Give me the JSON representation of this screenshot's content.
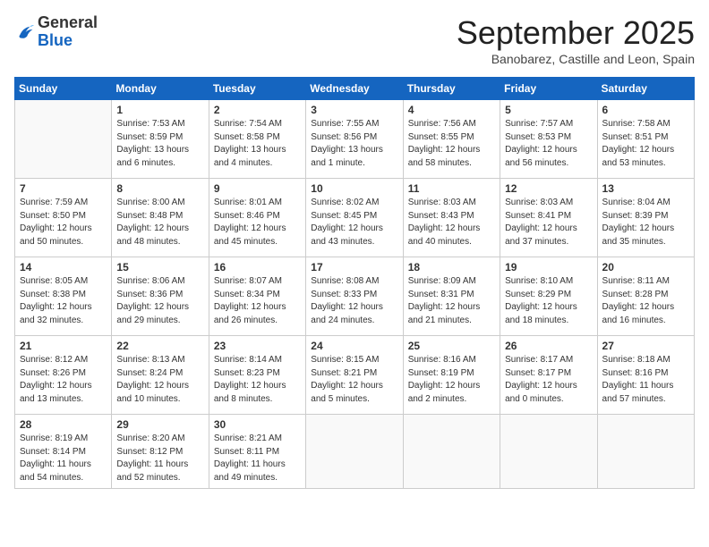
{
  "header": {
    "logo_general": "General",
    "logo_blue": "Blue",
    "month_title": "September 2025",
    "subtitle": "Banobarez, Castille and Leon, Spain"
  },
  "weekdays": [
    "Sunday",
    "Monday",
    "Tuesday",
    "Wednesday",
    "Thursday",
    "Friday",
    "Saturday"
  ],
  "weeks": [
    [
      {
        "day": "",
        "sunrise": "",
        "sunset": "",
        "daylight": ""
      },
      {
        "day": "1",
        "sunrise": "Sunrise: 7:53 AM",
        "sunset": "Sunset: 8:59 PM",
        "daylight": "Daylight: 13 hours and 6 minutes."
      },
      {
        "day": "2",
        "sunrise": "Sunrise: 7:54 AM",
        "sunset": "Sunset: 8:58 PM",
        "daylight": "Daylight: 13 hours and 4 minutes."
      },
      {
        "day": "3",
        "sunrise": "Sunrise: 7:55 AM",
        "sunset": "Sunset: 8:56 PM",
        "daylight": "Daylight: 13 hours and 1 minute."
      },
      {
        "day": "4",
        "sunrise": "Sunrise: 7:56 AM",
        "sunset": "Sunset: 8:55 PM",
        "daylight": "Daylight: 12 hours and 58 minutes."
      },
      {
        "day": "5",
        "sunrise": "Sunrise: 7:57 AM",
        "sunset": "Sunset: 8:53 PM",
        "daylight": "Daylight: 12 hours and 56 minutes."
      },
      {
        "day": "6",
        "sunrise": "Sunrise: 7:58 AM",
        "sunset": "Sunset: 8:51 PM",
        "daylight": "Daylight: 12 hours and 53 minutes."
      }
    ],
    [
      {
        "day": "7",
        "sunrise": "Sunrise: 7:59 AM",
        "sunset": "Sunset: 8:50 PM",
        "daylight": "Daylight: 12 hours and 50 minutes."
      },
      {
        "day": "8",
        "sunrise": "Sunrise: 8:00 AM",
        "sunset": "Sunset: 8:48 PM",
        "daylight": "Daylight: 12 hours and 48 minutes."
      },
      {
        "day": "9",
        "sunrise": "Sunrise: 8:01 AM",
        "sunset": "Sunset: 8:46 PM",
        "daylight": "Daylight: 12 hours and 45 minutes."
      },
      {
        "day": "10",
        "sunrise": "Sunrise: 8:02 AM",
        "sunset": "Sunset: 8:45 PM",
        "daylight": "Daylight: 12 hours and 43 minutes."
      },
      {
        "day": "11",
        "sunrise": "Sunrise: 8:03 AM",
        "sunset": "Sunset: 8:43 PM",
        "daylight": "Daylight: 12 hours and 40 minutes."
      },
      {
        "day": "12",
        "sunrise": "Sunrise: 8:03 AM",
        "sunset": "Sunset: 8:41 PM",
        "daylight": "Daylight: 12 hours and 37 minutes."
      },
      {
        "day": "13",
        "sunrise": "Sunrise: 8:04 AM",
        "sunset": "Sunset: 8:39 PM",
        "daylight": "Daylight: 12 hours and 35 minutes."
      }
    ],
    [
      {
        "day": "14",
        "sunrise": "Sunrise: 8:05 AM",
        "sunset": "Sunset: 8:38 PM",
        "daylight": "Daylight: 12 hours and 32 minutes."
      },
      {
        "day": "15",
        "sunrise": "Sunrise: 8:06 AM",
        "sunset": "Sunset: 8:36 PM",
        "daylight": "Daylight: 12 hours and 29 minutes."
      },
      {
        "day": "16",
        "sunrise": "Sunrise: 8:07 AM",
        "sunset": "Sunset: 8:34 PM",
        "daylight": "Daylight: 12 hours and 26 minutes."
      },
      {
        "day": "17",
        "sunrise": "Sunrise: 8:08 AM",
        "sunset": "Sunset: 8:33 PM",
        "daylight": "Daylight: 12 hours and 24 minutes."
      },
      {
        "day": "18",
        "sunrise": "Sunrise: 8:09 AM",
        "sunset": "Sunset: 8:31 PM",
        "daylight": "Daylight: 12 hours and 21 minutes."
      },
      {
        "day": "19",
        "sunrise": "Sunrise: 8:10 AM",
        "sunset": "Sunset: 8:29 PM",
        "daylight": "Daylight: 12 hours and 18 minutes."
      },
      {
        "day": "20",
        "sunrise": "Sunrise: 8:11 AM",
        "sunset": "Sunset: 8:28 PM",
        "daylight": "Daylight: 12 hours and 16 minutes."
      }
    ],
    [
      {
        "day": "21",
        "sunrise": "Sunrise: 8:12 AM",
        "sunset": "Sunset: 8:26 PM",
        "daylight": "Daylight: 12 hours and 13 minutes."
      },
      {
        "day": "22",
        "sunrise": "Sunrise: 8:13 AM",
        "sunset": "Sunset: 8:24 PM",
        "daylight": "Daylight: 12 hours and 10 minutes."
      },
      {
        "day": "23",
        "sunrise": "Sunrise: 8:14 AM",
        "sunset": "Sunset: 8:23 PM",
        "daylight": "Daylight: 12 hours and 8 minutes."
      },
      {
        "day": "24",
        "sunrise": "Sunrise: 8:15 AM",
        "sunset": "Sunset: 8:21 PM",
        "daylight": "Daylight: 12 hours and 5 minutes."
      },
      {
        "day": "25",
        "sunrise": "Sunrise: 8:16 AM",
        "sunset": "Sunset: 8:19 PM",
        "daylight": "Daylight: 12 hours and 2 minutes."
      },
      {
        "day": "26",
        "sunrise": "Sunrise: 8:17 AM",
        "sunset": "Sunset: 8:17 PM",
        "daylight": "Daylight: 12 hours and 0 minutes."
      },
      {
        "day": "27",
        "sunrise": "Sunrise: 8:18 AM",
        "sunset": "Sunset: 8:16 PM",
        "daylight": "Daylight: 11 hours and 57 minutes."
      }
    ],
    [
      {
        "day": "28",
        "sunrise": "Sunrise: 8:19 AM",
        "sunset": "Sunset: 8:14 PM",
        "daylight": "Daylight: 11 hours and 54 minutes."
      },
      {
        "day": "29",
        "sunrise": "Sunrise: 8:20 AM",
        "sunset": "Sunset: 8:12 PM",
        "daylight": "Daylight: 11 hours and 52 minutes."
      },
      {
        "day": "30",
        "sunrise": "Sunrise: 8:21 AM",
        "sunset": "Sunset: 8:11 PM",
        "daylight": "Daylight: 11 hours and 49 minutes."
      },
      {
        "day": "",
        "sunrise": "",
        "sunset": "",
        "daylight": ""
      },
      {
        "day": "",
        "sunrise": "",
        "sunset": "",
        "daylight": ""
      },
      {
        "day": "",
        "sunrise": "",
        "sunset": "",
        "daylight": ""
      },
      {
        "day": "",
        "sunrise": "",
        "sunset": "",
        "daylight": ""
      }
    ]
  ]
}
